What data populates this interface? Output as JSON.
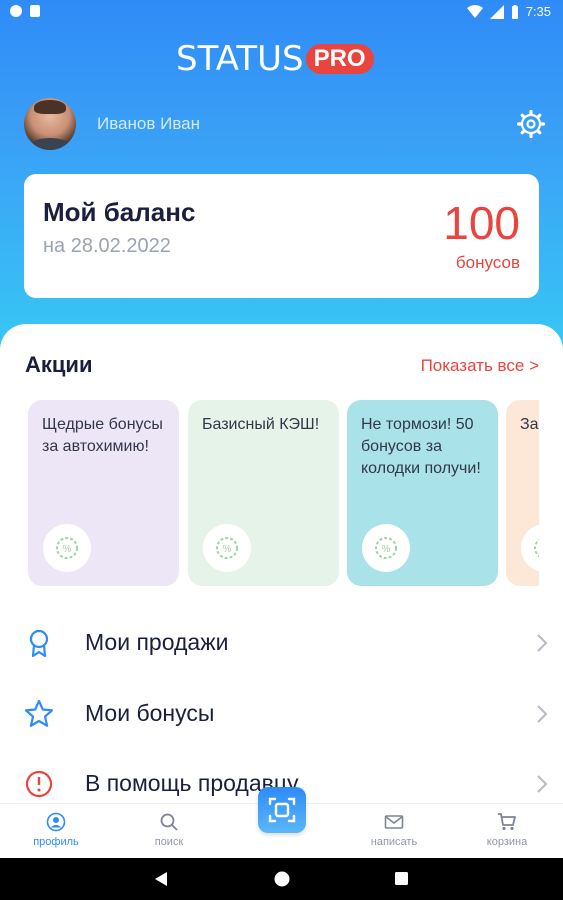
{
  "status_bar": {
    "time": "7:35"
  },
  "brand": {
    "name": "STATUS",
    "badge": "PRO",
    "primary_color": "#2f8bf7",
    "accent_color": "#e9443e"
  },
  "user": {
    "name": "Иванов Иван"
  },
  "balance": {
    "title": "Мой баланс",
    "date": "на 28.02.2022",
    "amount": "100",
    "unit": "бонусов"
  },
  "promotions": {
    "title": "Акции",
    "show_all": "Показать все >",
    "items": [
      {
        "text": "Щедрые бонусы за автохимию!",
        "color": "#ece6f7"
      },
      {
        "text": "Базисный КЭШ!",
        "color": "#e6f3e9"
      },
      {
        "text": "Не тормози! 50 бонусов за колодки получи!",
        "color": "#a9e2e8"
      },
      {
        "text": "За ВА",
        "color": "#fde8d7"
      }
    ]
  },
  "menu": [
    {
      "label": "Мои продажи",
      "icon": "award-icon"
    },
    {
      "label": "Мои бонусы",
      "icon": "star-icon"
    },
    {
      "label": "В помощь продавцу",
      "icon": "alert-icon"
    }
  ],
  "bottom_nav": [
    {
      "label": "профиль",
      "icon": "profile-icon",
      "active": true
    },
    {
      "label": "поиск",
      "icon": "search-icon",
      "active": false
    },
    {
      "label": "",
      "icon": "scan-icon",
      "active": false
    },
    {
      "label": "написать",
      "icon": "mail-icon",
      "active": false
    },
    {
      "label": "корзина",
      "icon": "cart-icon",
      "active": false
    }
  ]
}
